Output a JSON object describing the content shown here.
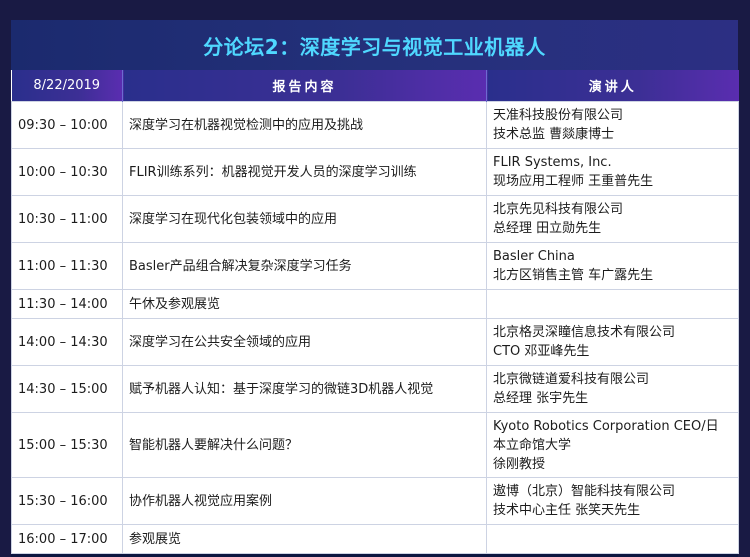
{
  "title": "分论坛2：深度学习与视觉工业机器人",
  "header": {
    "date": "8/22/2019",
    "topic": "报告内容",
    "speaker": "演讲人"
  },
  "rows": [
    {
      "time": "09:30 – 10:00",
      "topic": "深度学习在机器视觉检测中的应用及挑战",
      "speaker": [
        "天准科技股份有限公司",
        "技术总监 曹燚康博士"
      ]
    },
    {
      "time": "10:00 – 10:30",
      "topic": "FLIR训练系列：机器视觉开发人员的深度学习训练",
      "speaker": [
        "FLIR Systems, Inc.",
        "现场应用工程师 王重普先生"
      ]
    },
    {
      "time": "10:30 – 11:00",
      "topic": "深度学习在现代化包装领域中的应用",
      "speaker": [
        "北京先见科技有限公司",
        "总经理 田立勋先生"
      ]
    },
    {
      "time": "11:00 – 11:30",
      "topic": "Basler产品组合解决复杂深度学习任务",
      "speaker": [
        "Basler China",
        "北方区销售主管 车广露先生"
      ]
    },
    {
      "time": "11:30 – 14:00",
      "topic": "午休及参观展览",
      "speaker": []
    },
    {
      "time": "14:00 – 14:30",
      "topic": "深度学习在公共安全领域的应用",
      "speaker": [
        "北京格灵深瞳信息技术有限公司",
        "CTO 邓亚峰先生"
      ]
    },
    {
      "time": "14:30 – 15:00",
      "topic": "赋予机器人认知：基于深度学习的微链3D机器人视觉",
      "speaker": [
        "北京微链道爱科技有限公司",
        "总经理 张宇先生"
      ]
    },
    {
      "time": "15:00 – 15:30",
      "topic": "智能机器人要解决什么问题？",
      "speaker": [
        "Kyoto Robotics Corporation CEO/日",
        "本立命馆大学",
        "徐刚教授"
      ]
    },
    {
      "time": "15:30 – 16:00",
      "topic": "协作机器人视觉应用案例",
      "speaker": [
        "遨博（北京）智能科技有限公司",
        "技术中心主任 张笑天先生"
      ]
    },
    {
      "time": "16:00 – 17:00",
      "topic": "参观展览",
      "speaker": []
    }
  ]
}
